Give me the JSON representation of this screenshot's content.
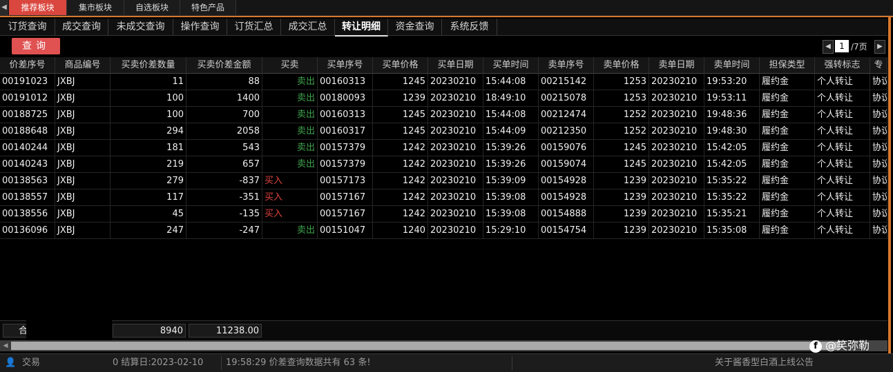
{
  "top_tabs": [
    "推荐板块",
    "集市板块",
    "自选板块",
    "特色产品"
  ],
  "sub_tabs": [
    "订货查询",
    "成交查询",
    "未成交查询",
    "操作查询",
    "订货汇总",
    "成交汇总",
    "转让明细",
    "资金查询",
    "系统反馈"
  ],
  "query_button": "查询",
  "pager": {
    "current": "1",
    "total": "/7页"
  },
  "columns": [
    "价差序号",
    "商品编号",
    "买卖价差数量",
    "买卖价差金额",
    "买卖",
    "买单序号",
    "买单价格",
    "买单日期",
    "买单时间",
    "卖单序号",
    "卖单价格",
    "卖单日期",
    "卖单时间",
    "担保类型",
    "强转标志",
    "专"
  ],
  "rows": [
    [
      "00191023",
      "JXBJ",
      "11",
      "88",
      "卖出",
      "00160313",
      "1245",
      "20230210",
      "15:44:08",
      "00215142",
      "1253",
      "20230210",
      "19:53:20",
      "履约金",
      "个人转让",
      "协议"
    ],
    [
      "00191012",
      "JXBJ",
      "100",
      "1400",
      "卖出",
      "00180093",
      "1239",
      "20230210",
      "18:49:10",
      "00215078",
      "1253",
      "20230210",
      "19:53:11",
      "履约金",
      "个人转让",
      "协议"
    ],
    [
      "00188725",
      "JXBJ",
      "100",
      "700",
      "卖出",
      "00160313",
      "1245",
      "20230210",
      "15:44:08",
      "00212474",
      "1252",
      "20230210",
      "19:48:36",
      "履约金",
      "个人转让",
      "协议"
    ],
    [
      "00188648",
      "JXBJ",
      "294",
      "2058",
      "卖出",
      "00160317",
      "1245",
      "20230210",
      "15:44:09",
      "00212350",
      "1252",
      "20230210",
      "19:48:30",
      "履约金",
      "个人转让",
      "协议"
    ],
    [
      "00140244",
      "JXBJ",
      "181",
      "543",
      "卖出",
      "00157379",
      "1242",
      "20230210",
      "15:39:26",
      "00159076",
      "1245",
      "20230210",
      "15:42:05",
      "履约金",
      "个人转让",
      "协议"
    ],
    [
      "00140243",
      "JXBJ",
      "219",
      "657",
      "卖出",
      "00157379",
      "1242",
      "20230210",
      "15:39:26",
      "00159074",
      "1245",
      "20230210",
      "15:42:05",
      "履约金",
      "个人转让",
      "协议"
    ],
    [
      "00138563",
      "JXBJ",
      "279",
      "-837",
      "买入",
      "00157173",
      "1242",
      "20230210",
      "15:39:09",
      "00154928",
      "1239",
      "20230210",
      "15:35:22",
      "履约金",
      "个人转让",
      "协议"
    ],
    [
      "00138557",
      "JXBJ",
      "117",
      "-351",
      "买入",
      "00157167",
      "1242",
      "20230210",
      "15:39:08",
      "00154928",
      "1239",
      "20230210",
      "15:35:22",
      "履约金",
      "个人转让",
      "协议"
    ],
    [
      "00138556",
      "JXBJ",
      "45",
      "-135",
      "买入",
      "00157167",
      "1242",
      "20230210",
      "15:39:08",
      "00154888",
      "1239",
      "20230210",
      "15:35:21",
      "履约金",
      "个人转让",
      "协议"
    ],
    [
      "00136096",
      "JXBJ",
      "247",
      "-247",
      "卖出",
      "00151047",
      "1240",
      "20230210",
      "15:29:10",
      "00154754",
      "1239",
      "20230210",
      "15:35:08",
      "履约金",
      "个人转让",
      "协议"
    ]
  ],
  "totals": {
    "label": "合",
    "quantity": "8940",
    "amount": "11238.00"
  },
  "status": {
    "left": "交易",
    "settle": "0 结算日:2023-02-10",
    "message": "19:58:29 价差查询数据共有 63 条!",
    "notice": "关于酱香型白酒上线公告"
  },
  "watermark": "@笑弥勒",
  "colors": {
    "accent_red": "#d9473f",
    "orange": "#d7782f",
    "sell_green": "#3fa34d",
    "buy_red": "#e0453e"
  }
}
